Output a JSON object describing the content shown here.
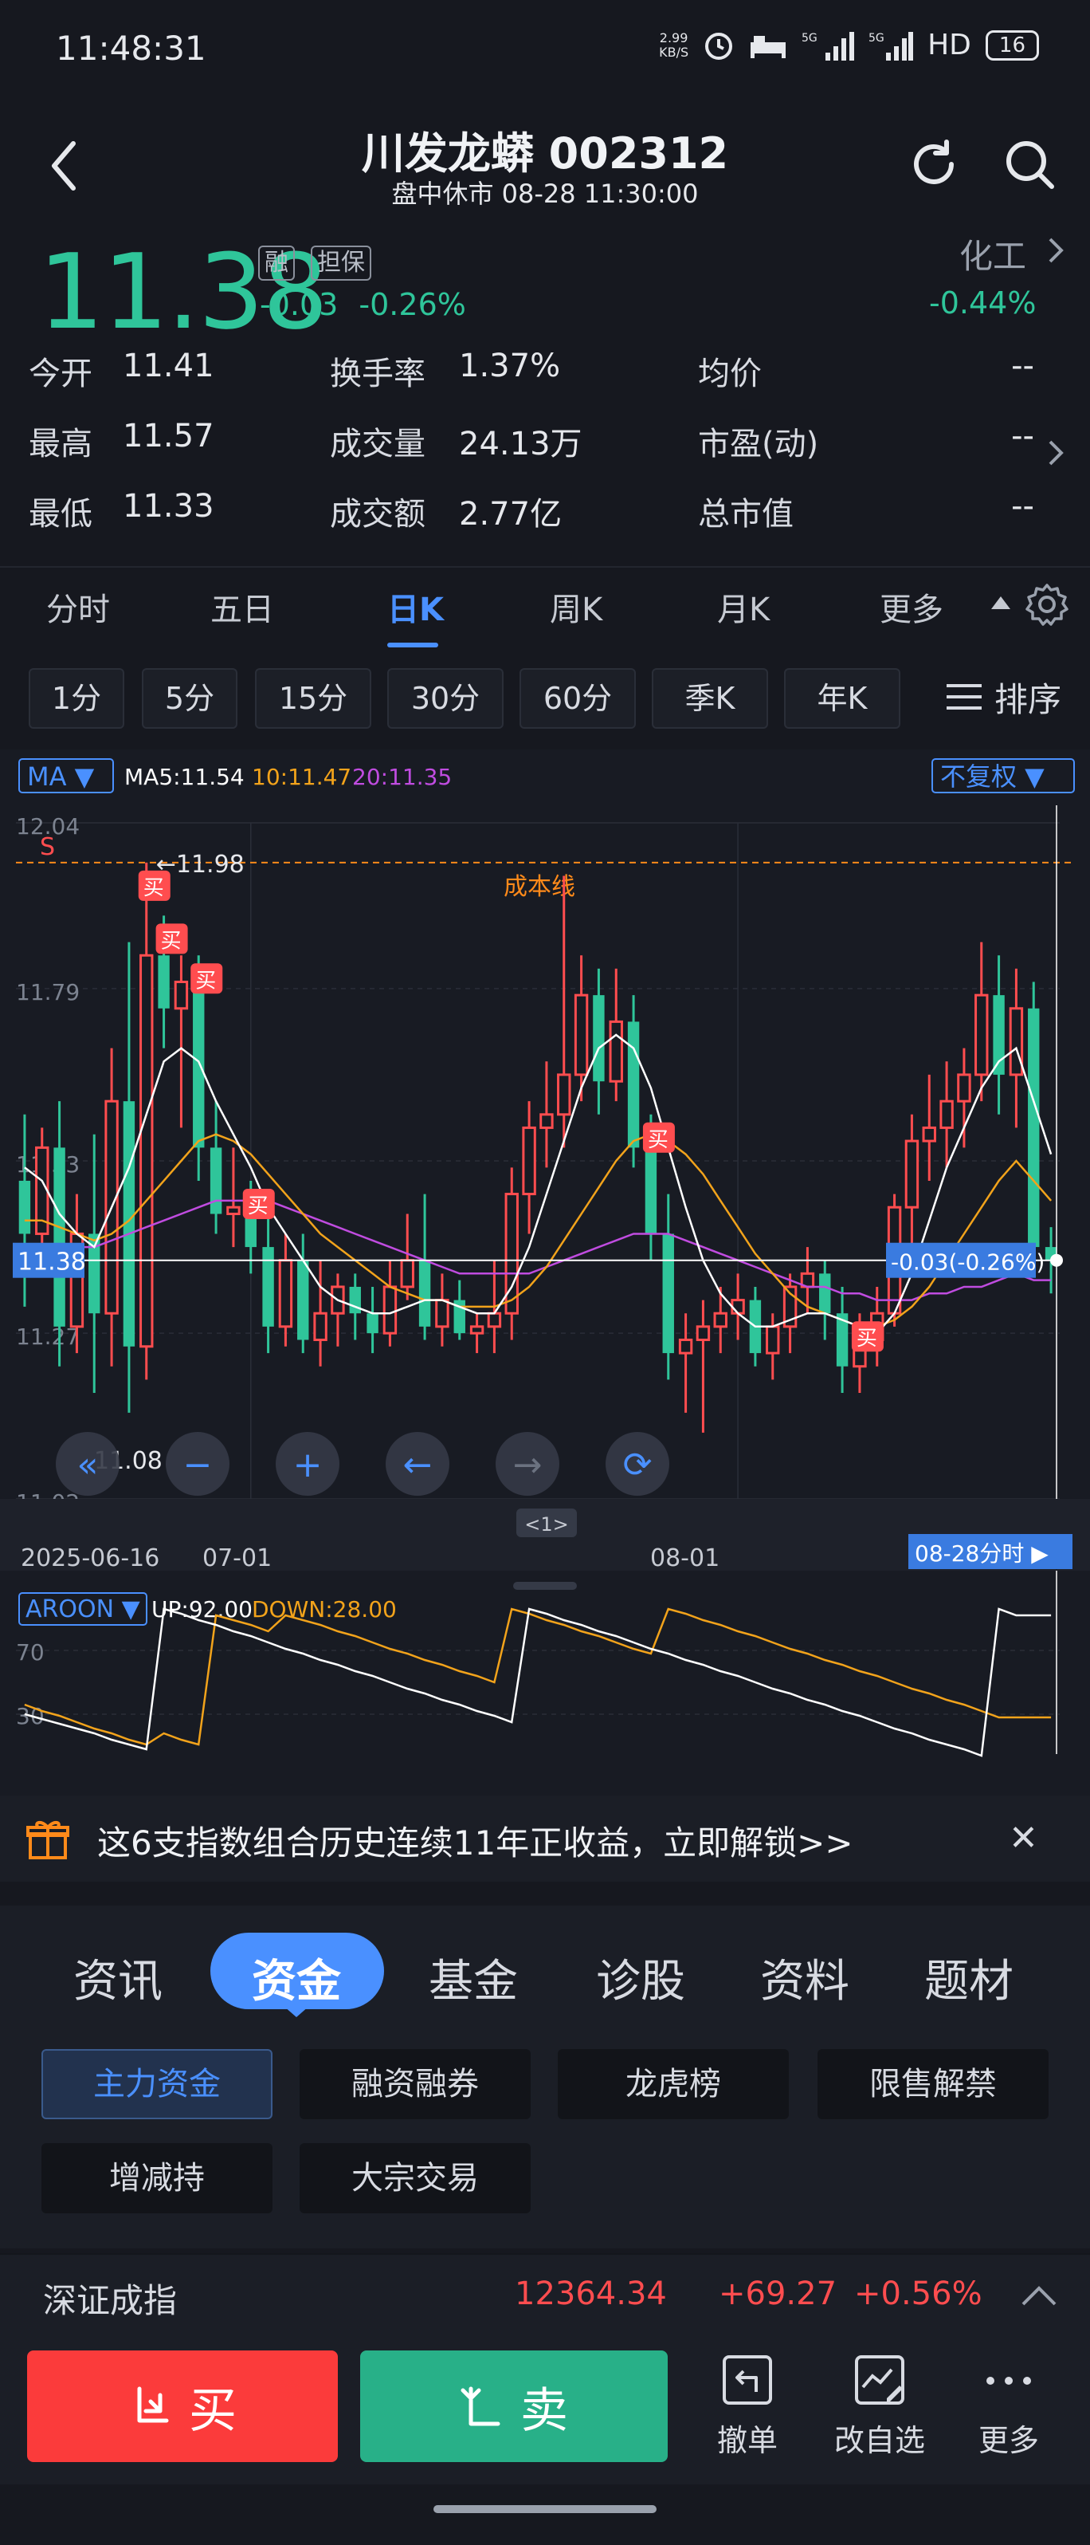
{
  "status_bar": {
    "time": "11:48:31",
    "net_speed_value": "2.99",
    "net_speed_unit": "KB/S",
    "network": "5G",
    "hd": "HD",
    "battery": "16"
  },
  "header": {
    "title": "川发龙蟒 002312",
    "subtitle": "盘中休市 08-28 11:30:00"
  },
  "quote": {
    "price": "11.38",
    "tag_rong": "融",
    "tag_danbao": "担保",
    "change": "-0.03",
    "change_pct": "-0.26%",
    "sector": "化工",
    "sector_change": "-0.44%"
  },
  "stats": [
    {
      "label": "今开",
      "value": "11.41",
      "tone": ""
    },
    {
      "label": "换手率",
      "value": "1.37%",
      "tone": ""
    },
    {
      "label": "均价",
      "value": "--",
      "tone": ""
    },
    {
      "label": "最高",
      "value": "11.57",
      "tone": "red"
    },
    {
      "label": "成交量",
      "value": "24.13万",
      "tone": ""
    },
    {
      "label": "市盈(动)",
      "value": "--",
      "tone": ""
    },
    {
      "label": "最低",
      "value": "11.33",
      "tone": "green"
    },
    {
      "label": "成交额",
      "value": "2.77亿",
      "tone": ""
    },
    {
      "label": "总市值",
      "value": "--",
      "tone": ""
    }
  ],
  "period_tabs": [
    "分时",
    "五日",
    "日K",
    "周K",
    "月K",
    "更多"
  ],
  "active_period": "日K",
  "minute_buttons": [
    "1分",
    "5分",
    "15分",
    "30分",
    "60分",
    "季K",
    "年K"
  ],
  "sort_label": "排序",
  "chart_data": {
    "type": "candlestick",
    "y_axis_ticks": [
      "12.04",
      "11.79",
      "11.53",
      "11.27",
      "11.02"
    ],
    "ylim": [
      11.02,
      12.04
    ],
    "x_axis_ticks": [
      "2025-06-16",
      "07-01",
      "08-01"
    ],
    "current_price_label": "11.38",
    "current_change_label": "-0.03(-0.26%)",
    "high_marker": "←11.98",
    "low_marker": "11.08",
    "cost_line_label": "成本线",
    "cost_line_value": 11.98,
    "sell_marker": "S",
    "buy_marker": "买",
    "ma_selector": "MA",
    "ma_legend": [
      "MA5:11.54",
      "10:11.47",
      "20:11.35"
    ],
    "adjust_selector": "不复权",
    "intraday_link": "08-28分时",
    "scroll_handle": "<1>",
    "candles": [
      {
        "o": 11.5,
        "h": 11.6,
        "l": 11.31,
        "c": 11.42
      },
      {
        "o": 11.42,
        "h": 11.58,
        "l": 11.36,
        "c": 11.55
      },
      {
        "o": 11.55,
        "h": 11.62,
        "l": 11.22,
        "c": 11.28
      },
      {
        "o": 11.28,
        "h": 11.48,
        "l": 11.24,
        "c": 11.42
      },
      {
        "o": 11.42,
        "h": 11.57,
        "l": 11.18,
        "c": 11.3
      },
      {
        "o": 11.3,
        "h": 11.7,
        "l": 11.22,
        "c": 11.62
      },
      {
        "o": 11.62,
        "h": 11.86,
        "l": 11.15,
        "c": 11.25
      },
      {
        "o": 11.25,
        "h": 11.98,
        "l": 11.2,
        "c": 11.84
      },
      {
        "o": 11.84,
        "h": 11.9,
        "l": 11.7,
        "c": 11.76
      },
      {
        "o": 11.76,
        "h": 11.84,
        "l": 11.58,
        "c": 11.8
      },
      {
        "o": 11.8,
        "h": 11.84,
        "l": 11.5,
        "c": 11.55
      },
      {
        "o": 11.55,
        "h": 11.62,
        "l": 11.42,
        "c": 11.45
      },
      {
        "o": 11.45,
        "h": 11.55,
        "l": 11.4,
        "c": 11.46
      },
      {
        "o": 11.46,
        "h": 11.5,
        "l": 11.36,
        "c": 11.4
      },
      {
        "o": 11.4,
        "h": 11.45,
        "l": 11.24,
        "c": 11.28
      },
      {
        "o": 11.28,
        "h": 11.42,
        "l": 11.25,
        "c": 11.38
      },
      {
        "o": 11.38,
        "h": 11.42,
        "l": 11.24,
        "c": 11.26
      },
      {
        "o": 11.26,
        "h": 11.38,
        "l": 11.22,
        "c": 11.3
      },
      {
        "o": 11.3,
        "h": 11.36,
        "l": 11.25,
        "c": 11.34
      },
      {
        "o": 11.34,
        "h": 11.36,
        "l": 11.26,
        "c": 11.3
      },
      {
        "o": 11.3,
        "h": 11.34,
        "l": 11.24,
        "c": 11.27
      },
      {
        "o": 11.27,
        "h": 11.38,
        "l": 11.25,
        "c": 11.34
      },
      {
        "o": 11.34,
        "h": 11.45,
        "l": 11.32,
        "c": 11.38
      },
      {
        "o": 11.38,
        "h": 11.48,
        "l": 11.26,
        "c": 11.28
      },
      {
        "o": 11.28,
        "h": 11.36,
        "l": 11.25,
        "c": 11.32
      },
      {
        "o": 11.32,
        "h": 11.35,
        "l": 11.26,
        "c": 11.27
      },
      {
        "o": 11.27,
        "h": 11.3,
        "l": 11.24,
        "c": 11.28
      },
      {
        "o": 11.28,
        "h": 11.38,
        "l": 11.24,
        "c": 11.3
      },
      {
        "o": 11.3,
        "h": 11.52,
        "l": 11.26,
        "c": 11.48
      },
      {
        "o": 11.48,
        "h": 11.62,
        "l": 11.42,
        "c": 11.58
      },
      {
        "o": 11.58,
        "h": 11.68,
        "l": 11.52,
        "c": 11.6
      },
      {
        "o": 11.6,
        "h": 11.96,
        "l": 11.55,
        "c": 11.66
      },
      {
        "o": 11.66,
        "h": 11.84,
        "l": 11.62,
        "c": 11.78
      },
      {
        "o": 11.78,
        "h": 11.82,
        "l": 11.6,
        "c": 11.65
      },
      {
        "o": 11.65,
        "h": 11.82,
        "l": 11.62,
        "c": 11.74
      },
      {
        "o": 11.74,
        "h": 11.78,
        "l": 11.52,
        "c": 11.55
      },
      {
        "o": 11.55,
        "h": 11.6,
        "l": 11.38,
        "c": 11.42
      },
      {
        "o": 11.42,
        "h": 11.48,
        "l": 11.2,
        "c": 11.24
      },
      {
        "o": 11.24,
        "h": 11.3,
        "l": 11.15,
        "c": 11.26
      },
      {
        "o": 11.26,
        "h": 11.32,
        "l": 11.12,
        "c": 11.28
      },
      {
        "o": 11.28,
        "h": 11.34,
        "l": 11.24,
        "c": 11.3
      },
      {
        "o": 11.3,
        "h": 11.36,
        "l": 11.26,
        "c": 11.32
      },
      {
        "o": 11.32,
        "h": 11.34,
        "l": 11.22,
        "c": 11.24
      },
      {
        "o": 11.24,
        "h": 11.3,
        "l": 11.2,
        "c": 11.28
      },
      {
        "o": 11.28,
        "h": 11.36,
        "l": 11.24,
        "c": 11.34
      },
      {
        "o": 11.34,
        "h": 11.4,
        "l": 11.3,
        "c": 11.36
      },
      {
        "o": 11.36,
        "h": 11.38,
        "l": 11.26,
        "c": 11.3
      },
      {
        "o": 11.3,
        "h": 11.34,
        "l": 11.18,
        "c": 11.22
      },
      {
        "o": 11.22,
        "h": 11.3,
        "l": 11.18,
        "c": 11.26
      },
      {
        "o": 11.26,
        "h": 11.34,
        "l": 11.22,
        "c": 11.3
      },
      {
        "o": 11.3,
        "h": 11.48,
        "l": 11.28,
        "c": 11.46
      },
      {
        "o": 11.46,
        "h": 11.6,
        "l": 11.4,
        "c": 11.56
      },
      {
        "o": 11.56,
        "h": 11.66,
        "l": 11.5,
        "c": 11.58
      },
      {
        "o": 11.58,
        "h": 11.68,
        "l": 11.52,
        "c": 11.62
      },
      {
        "o": 11.62,
        "h": 11.7,
        "l": 11.55,
        "c": 11.66
      },
      {
        "o": 11.66,
        "h": 11.86,
        "l": 11.62,
        "c": 11.78
      },
      {
        "o": 11.78,
        "h": 11.84,
        "l": 11.6,
        "c": 11.66
      },
      {
        "o": 11.66,
        "h": 11.82,
        "l": 11.58,
        "c": 11.76
      },
      {
        "o": 11.76,
        "h": 11.8,
        "l": 11.36,
        "c": 11.4
      },
      {
        "o": 11.4,
        "h": 11.43,
        "l": 11.33,
        "c": 11.38
      }
    ],
    "ma5": [
      11.52,
      11.5,
      11.45,
      11.42,
      11.4,
      11.46,
      11.52,
      11.6,
      11.68,
      11.7,
      11.68,
      11.62,
      11.57,
      11.52,
      11.46,
      11.42,
      11.38,
      11.34,
      11.32,
      11.31,
      11.3,
      11.3,
      11.31,
      11.32,
      11.32,
      11.31,
      11.3,
      11.3,
      11.34,
      11.4,
      11.48,
      11.56,
      11.64,
      11.7,
      11.72,
      11.7,
      11.64,
      11.55,
      11.46,
      11.38,
      11.33,
      11.3,
      11.28,
      11.28,
      11.29,
      11.3,
      11.3,
      11.29,
      11.28,
      11.27,
      11.3,
      11.36,
      11.44,
      11.52,
      11.58,
      11.64,
      11.68,
      11.7,
      11.62,
      11.54
    ],
    "ma10": [
      11.44,
      11.44,
      11.43,
      11.42,
      11.41,
      11.42,
      11.44,
      11.47,
      11.5,
      11.53,
      11.56,
      11.57,
      11.56,
      11.54,
      11.51,
      11.48,
      11.45,
      11.42,
      11.4,
      11.38,
      11.36,
      11.34,
      11.33,
      11.32,
      11.32,
      11.31,
      11.31,
      11.31,
      11.32,
      11.34,
      11.37,
      11.41,
      11.45,
      11.49,
      11.53,
      11.56,
      11.57,
      11.56,
      11.54,
      11.51,
      11.47,
      11.43,
      11.39,
      11.36,
      11.33,
      11.31,
      11.3,
      11.29,
      11.28,
      11.28,
      11.29,
      11.31,
      11.34,
      11.38,
      11.42,
      11.46,
      11.5,
      11.53,
      11.5,
      11.47
    ],
    "ma20": [
      11.4,
      11.4,
      11.4,
      11.4,
      11.4,
      11.41,
      11.42,
      11.43,
      11.44,
      11.45,
      11.46,
      11.47,
      11.47,
      11.47,
      11.47,
      11.46,
      11.45,
      11.44,
      11.43,
      11.42,
      11.41,
      11.4,
      11.39,
      11.38,
      11.37,
      11.36,
      11.36,
      11.36,
      11.36,
      11.36,
      11.37,
      11.38,
      11.39,
      11.4,
      11.41,
      11.42,
      11.42,
      11.42,
      11.41,
      11.4,
      11.39,
      11.38,
      11.37,
      11.36,
      11.35,
      11.34,
      11.34,
      11.33,
      11.33,
      11.32,
      11.32,
      11.32,
      11.33,
      11.33,
      11.34,
      11.34,
      11.35,
      11.36,
      11.35,
      11.35
    ],
    "buy_signals": [
      7,
      8,
      10,
      13,
      36,
      48
    ],
    "sell_signals": [
      0
    ]
  },
  "aroon": {
    "selector": "AROON",
    "up_label": "UP:92.00",
    "down_label": "DOWN:28.00",
    "ticks": [
      "70",
      "30"
    ],
    "up": [
      30,
      27,
      24,
      21,
      18,
      14,
      11,
      8,
      96,
      93,
      89,
      86,
      82,
      79,
      75,
      71,
      68,
      64,
      61,
      57,
      54,
      50,
      46,
      43,
      39,
      36,
      32,
      29,
      25,
      96,
      93,
      89,
      86,
      82,
      79,
      75,
      71,
      68,
      64,
      61,
      57,
      54,
      50,
      46,
      43,
      39,
      36,
      32,
      29,
      25,
      21,
      18,
      14,
      11,
      8,
      4,
      96,
      92,
      92,
      92
    ],
    "down": [
      36,
      32,
      29,
      25,
      21,
      18,
      14,
      11,
      18,
      14,
      11,
      92,
      89,
      86,
      82,
      92,
      89,
      86,
      82,
      79,
      75,
      71,
      68,
      64,
      61,
      57,
      54,
      50,
      96,
      93,
      89,
      86,
      82,
      79,
      75,
      71,
      68,
      96,
      93,
      89,
      86,
      82,
      79,
      75,
      71,
      68,
      64,
      61,
      57,
      54,
      50,
      46,
      43,
      39,
      36,
      32,
      28,
      28,
      28,
      28
    ]
  },
  "chart_controls": [
    "double-left",
    "minus",
    "plus",
    "left",
    "right",
    "rotate"
  ],
  "promo": {
    "text": "这6支指数组合历史连续11年正收益，立即解锁>>"
  },
  "info_tabs": [
    "资讯",
    "资金",
    "基金",
    "诊股",
    "资料",
    "题材"
  ],
  "active_info_tab": "资金",
  "sub_buttons": [
    "主力资金",
    "融资融券",
    "龙虎榜",
    "限售解禁",
    "增减持",
    "大宗交易"
  ],
  "index_bar": {
    "name": "深证成指",
    "value": "12364.34",
    "change": "+69.27",
    "pct": "+0.56%"
  },
  "bottom_bar": {
    "buy": "买",
    "sell": "卖",
    "cancel": "撤单",
    "watchlist": "改自选",
    "more": "更多"
  },
  "colors": {
    "up": "#ff4d4f",
    "down": "#2fc59a",
    "accent": "#4a90ff",
    "cost_line": "#ff8a1a",
    "ma5": "#ffffff",
    "ma10": "#f2a31b",
    "ma20": "#c04ce0"
  }
}
